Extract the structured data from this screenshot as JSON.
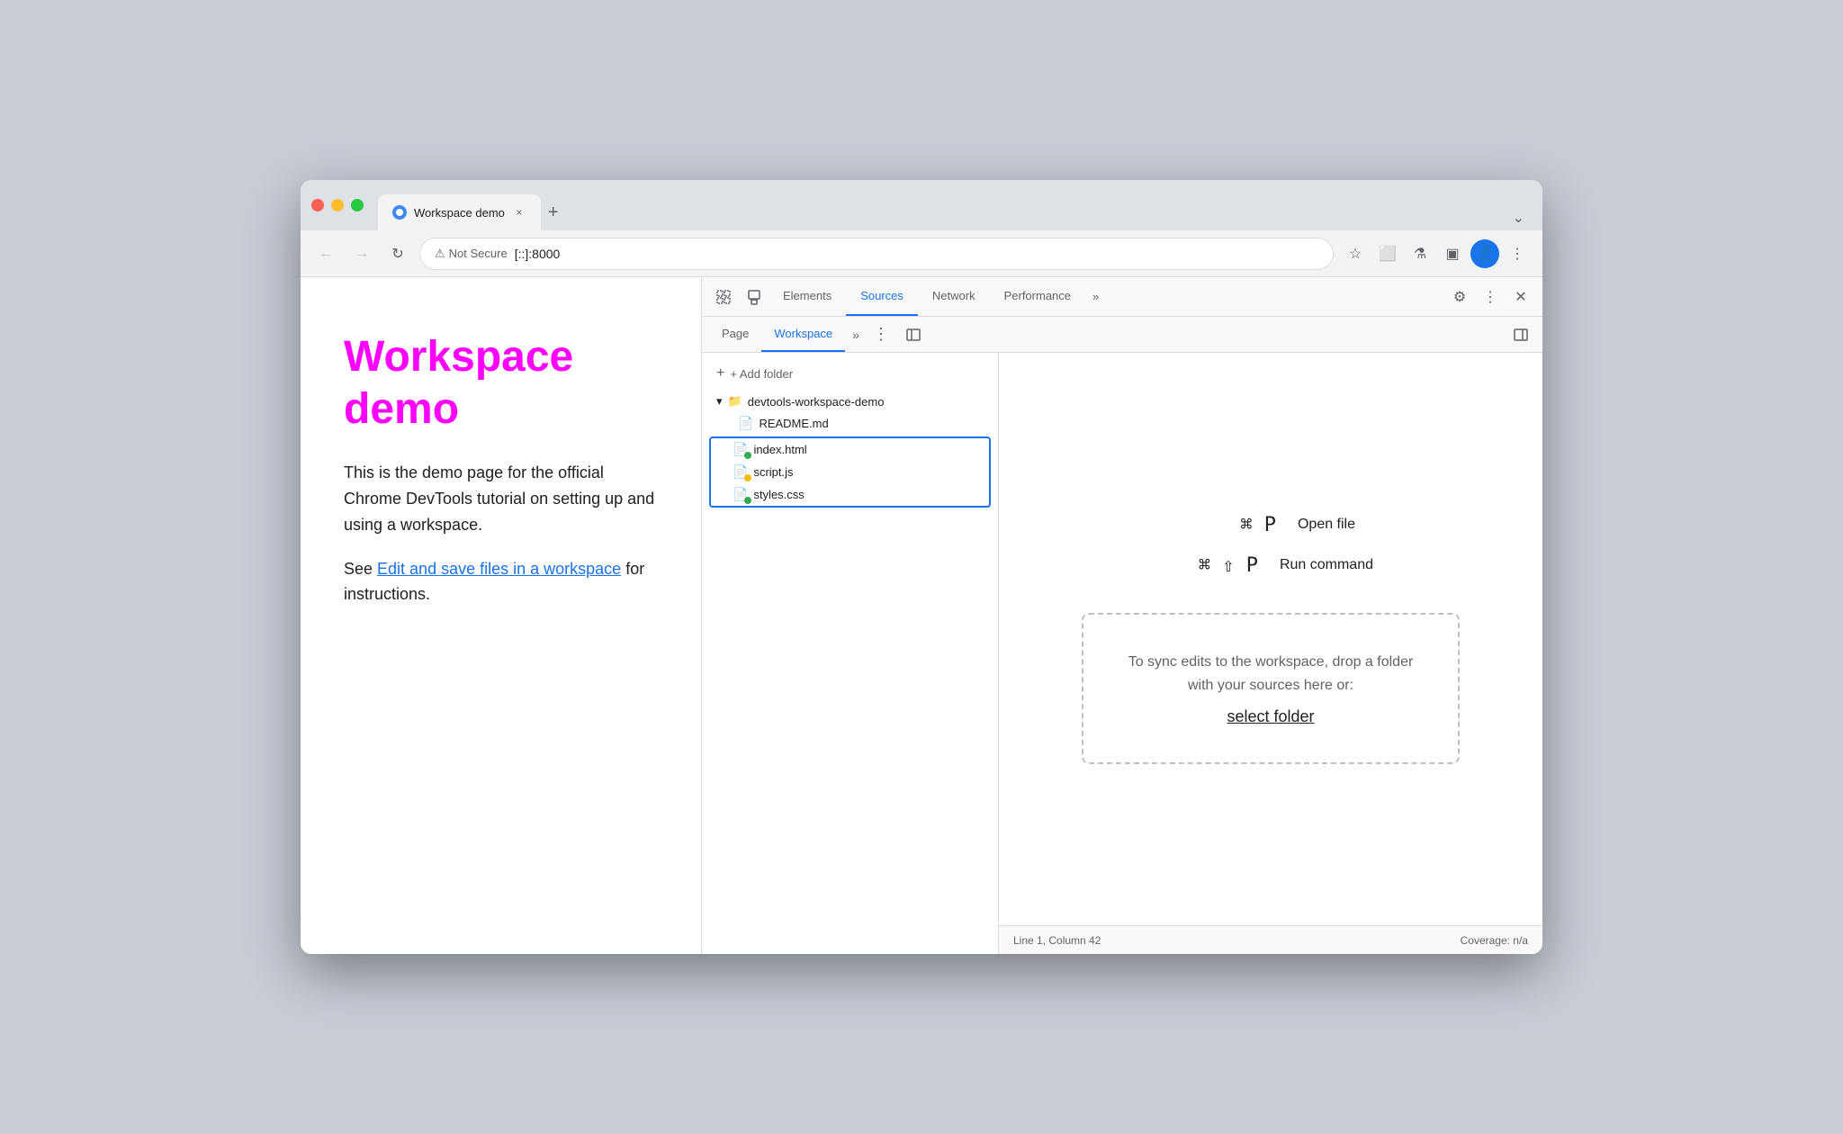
{
  "browser": {
    "tab_title": "Workspace demo",
    "tab_close": "×",
    "new_tab": "+",
    "tab_menu": "⌄",
    "address_bar": {
      "not_secure_label": "Not Secure",
      "url": "[::]:8000"
    },
    "nav": {
      "back": "←",
      "forward": "→",
      "refresh": "↻"
    }
  },
  "page": {
    "title": "Workspace demo",
    "description": "This is the demo page for the official Chrome DevTools tutorial on setting up and using a workspace.",
    "link_prefix": "See ",
    "link_text": "Edit and save files in a workspace",
    "link_suffix": " for instructions."
  },
  "devtools": {
    "top_tabs": {
      "items": [
        {
          "label": "Elements",
          "active": false
        },
        {
          "label": "Sources",
          "active": true
        },
        {
          "label": "Network",
          "active": false
        },
        {
          "label": "Performance",
          "active": false
        }
      ],
      "more": "»"
    },
    "sub_tabs": {
      "items": [
        {
          "label": "Page",
          "active": false
        },
        {
          "label": "Workspace",
          "active": true
        }
      ],
      "more": "»"
    },
    "add_folder_label": "+ Add folder",
    "folder": {
      "name": "devtools-workspace-demo",
      "files": [
        {
          "name": "README.md",
          "type": "plain",
          "dot_color": null
        },
        {
          "name": "index.html",
          "type": "html",
          "dot_color": "#34a853"
        },
        {
          "name": "script.js",
          "type": "js",
          "dot_color": "#fbbc04"
        },
        {
          "name": "styles.css",
          "type": "css",
          "dot_color": "#34a853"
        }
      ]
    },
    "shortcuts": [
      {
        "keys": "⌘ P",
        "label": "Open file"
      },
      {
        "keys": "⌘ ⇧ P",
        "label": "Run command"
      }
    ],
    "drop_zone": {
      "text": "To sync edits to the workspace, drop a folder with your sources here or:",
      "select_folder": "select folder"
    },
    "status_bar": {
      "position": "Line 1, Column 42",
      "coverage": "Coverage: n/a"
    }
  }
}
